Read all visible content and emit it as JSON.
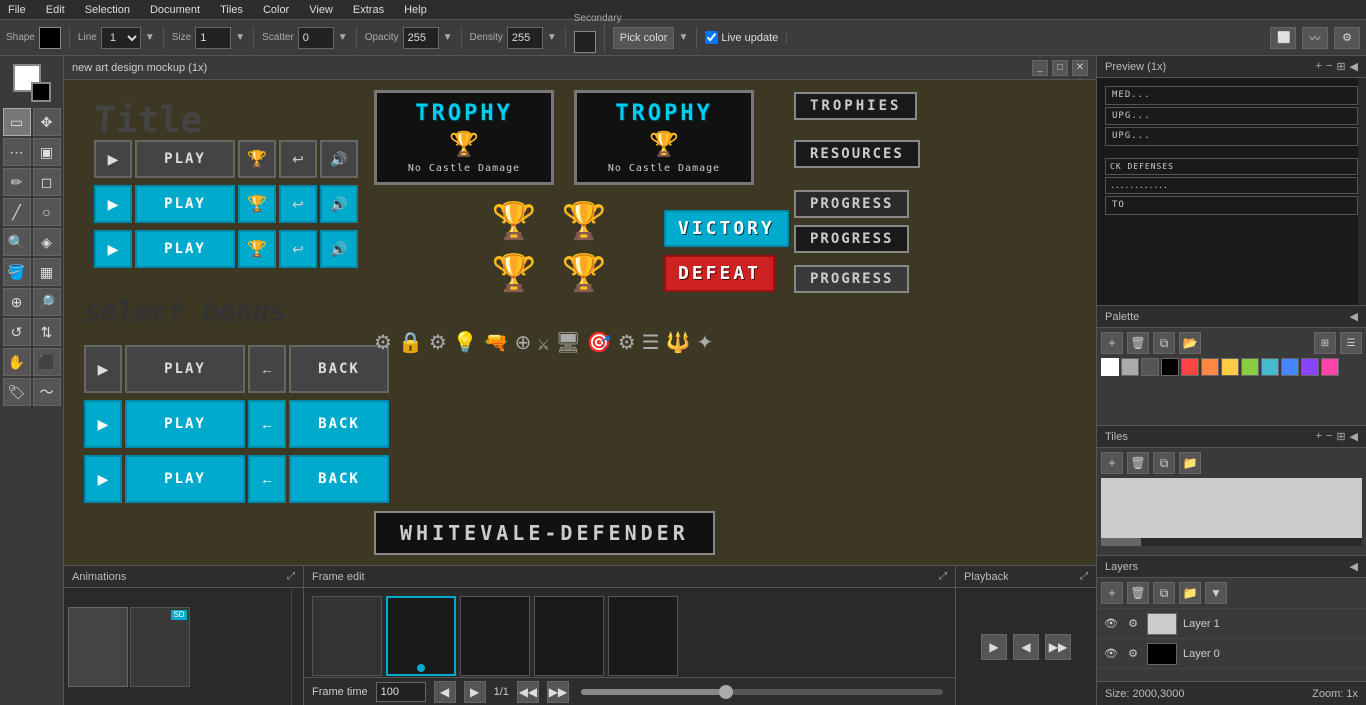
{
  "menu": {
    "items": [
      "File",
      "Edit",
      "Selection",
      "Document",
      "Tiles",
      "Color",
      "View",
      "Extras",
      "Help"
    ]
  },
  "toolbar": {
    "shape_label": "Shape",
    "line_label": "Line",
    "size_label": "Size",
    "scatter_label": "Scatter",
    "opacity_label": "Opacity",
    "density_label": "Density",
    "secondary_label": "Secondary",
    "size_value": "1",
    "scatter_value": "0",
    "opacity_value": "255",
    "density_value": "255",
    "pick_color_label": "Pick color",
    "live_update_label": "Live update",
    "line_value": "1"
  },
  "canvas": {
    "title": "new art design mockup  (1x)"
  },
  "panels": {
    "preview_title": "Preview (1x)",
    "palette_title": "Palette",
    "tiles_title": "Tiles",
    "layers_title": "Layers",
    "animations_title": "Animations",
    "frame_edit_title": "Frame edit",
    "playback_title": "Playback",
    "info_size": "Size: 2000,3000",
    "info_zoom": "Zoom: 1x"
  },
  "frame_controls": {
    "frame_time_label": "Frame time",
    "frame_time_value": "100",
    "frame_counter": "1/1"
  },
  "layers": [
    {
      "name": "Layer 1",
      "visible": true,
      "thumb_color": "light"
    },
    {
      "name": "Layer 0",
      "visible": true,
      "thumb_color": "dark"
    }
  ],
  "palette_colors": [
    "#FFFFFF",
    "#AAAAAA",
    "#555555",
    "#000000",
    "#FF4444",
    "#FF8844",
    "#FFCC44",
    "#88CC44",
    "#44BBCC",
    "#4488FF",
    "#8844FF",
    "#FF44AA",
    "#00CCDD",
    "#00AAAA",
    "#005566",
    "#002233"
  ],
  "game_content": {
    "title_text": "Title",
    "select_bonus_text": "select bonus",
    "trophy1_title": "TROPHY",
    "trophy1_subtitle": "No Castle Damage",
    "trophy2_title": "TROPHY",
    "trophy2_subtitle": "No Castle Damage",
    "trophies_label": "TROPHIES",
    "resources_label": "RESOURCES",
    "progress_label1": "PROGRESS",
    "progress_label2": "PROGRESS",
    "progress_label3": "PROGRESS",
    "victory_label": "VICTORY",
    "defeat_label": "DEFEAT",
    "game_title": "WHITEVALE-DEFENDER",
    "play_label": "PLAY",
    "back_label": "BACK"
  },
  "icons": {
    "zoom_in": "+",
    "zoom_out": "−",
    "grid": "⊞",
    "arrow_left": "←",
    "arrow_right": "→",
    "play": "▶",
    "stop": "■",
    "rewind": "◀◀",
    "forward": "▶▶",
    "settings": "⚙",
    "eye": "👁",
    "add": "+",
    "delete": "🗑",
    "copy": "⧉",
    "folder": "📁",
    "move_up": "▲",
    "move_down": "▼"
  }
}
